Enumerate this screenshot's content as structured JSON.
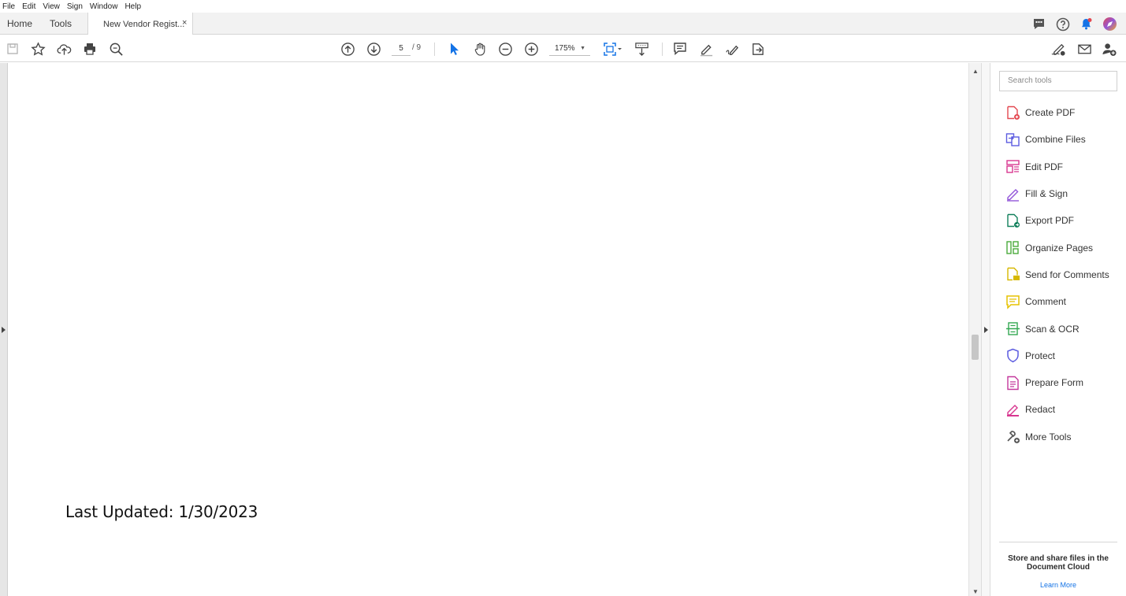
{
  "menu": [
    "File",
    "Edit",
    "View",
    "Sign",
    "Window",
    "Help"
  ],
  "tabs": {
    "home": "Home",
    "tools": "Tools",
    "document": "New Vendor Regist...",
    "close": "×"
  },
  "toolbar": {
    "page_current": "5",
    "page_total": "/ 9",
    "zoom": "175%"
  },
  "document": {
    "last_updated": "Last Updated: 1/30/2023"
  },
  "right_pane": {
    "search_placeholder": "Search tools",
    "tools": [
      {
        "label": "Create PDF",
        "icon": "create-pdf-icon",
        "color": "#e34850"
      },
      {
        "label": "Combine Files",
        "icon": "combine-files-icon",
        "color": "#5c5ce0"
      },
      {
        "label": "Edit PDF",
        "icon": "edit-pdf-icon",
        "color": "#d83790"
      },
      {
        "label": "Fill & Sign",
        "icon": "fill-sign-icon",
        "color": "#9256d9"
      },
      {
        "label": "Export PDF",
        "icon": "export-pdf-icon",
        "color": "#12805c"
      },
      {
        "label": "Organize Pages",
        "icon": "organize-pages-icon",
        "color": "#4bab3c"
      },
      {
        "label": "Send for Comments",
        "icon": "send-for-comments-icon",
        "color": "#d7b800"
      },
      {
        "label": "Comment",
        "icon": "comment-icon",
        "color": "#e6c200"
      },
      {
        "label": "Scan & OCR",
        "icon": "scan-ocr-icon",
        "color": "#33a852"
      },
      {
        "label": "Protect",
        "icon": "protect-icon",
        "color": "#5c5ce0"
      },
      {
        "label": "Prepare Form",
        "icon": "prepare-form-icon",
        "color": "#c4389c"
      },
      {
        "label": "Redact",
        "icon": "redact-icon",
        "color": "#d83790"
      },
      {
        "label": "More Tools",
        "icon": "more-tools-icon",
        "color": "#555555"
      }
    ],
    "cloud_text": "Store and share files in the Document Cloud",
    "learn_more": "Learn More"
  }
}
